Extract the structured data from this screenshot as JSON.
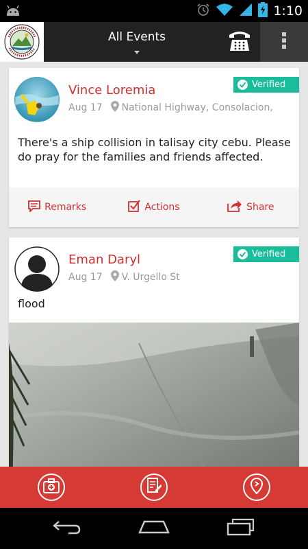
{
  "status_bar": {
    "time": "1:10"
  },
  "header": {
    "title": "All Events"
  },
  "posts": [
    {
      "author": "Vince Loremia",
      "date": "Aug 17",
      "location": "National Highway, Consolacion,",
      "badge": "Verified",
      "text": "There's a ship collision in talisay city cebu. Please do pray for the families and friends affected.",
      "actions": {
        "remarks": "Remarks",
        "actions": "Actions",
        "share": "Share"
      }
    },
    {
      "author": "Eman Daryl",
      "date": "Aug 17",
      "location": "V. Urgello St",
      "badge": "Verified",
      "text": "flood"
    }
  ],
  "colors": {
    "accent": "#d32f2f",
    "verified": "#1abc9c",
    "bottom_bar": "#d63a35",
    "action_bar": "#222222"
  },
  "icons": {
    "status_left": "android-icon",
    "status_right": [
      "alarm-icon",
      "wifi-icon",
      "signal-icon",
      "battery-charging-icon"
    ],
    "header": [
      "seal-logo",
      "phone-keypad-icon",
      "overflow-menu-icon"
    ],
    "bottom_bar": [
      "first-aid-kit-icon",
      "report-document-icon",
      "location-pin-icon"
    ],
    "nav": [
      "back-icon",
      "home-icon",
      "recent-apps-icon"
    ]
  }
}
